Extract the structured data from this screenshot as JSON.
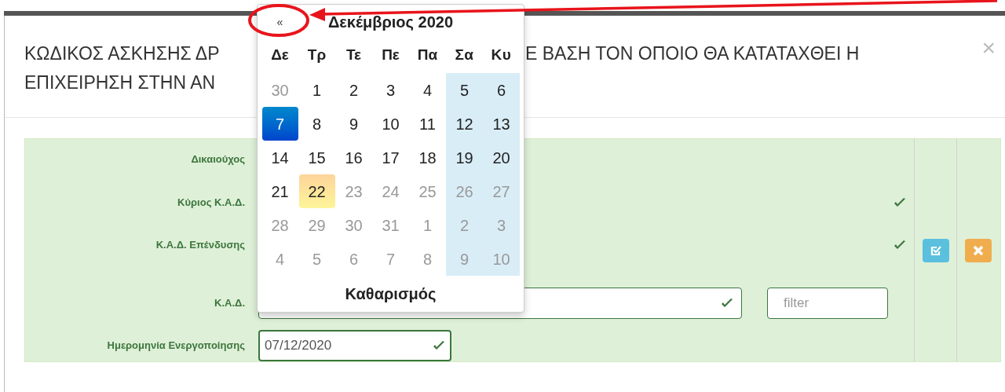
{
  "modal": {
    "title_parts": [
      "ΚΩΔΙΚΟΣ ΑΣΚΗΣΗΣ ΔΡ",
      "Ε ΒΑΣΗ ΤΟΝ ΟΠΟΙΟ ΘΑ ΚΑΤΑΤΑΧΘΕΙ Η",
      "ΕΠΙΧΕΙΡΗΣΗ ΣΤΗΝ ΑΝ"
    ],
    "close": "×"
  },
  "form": {
    "rows": [
      {
        "label": "Δικαιούχος",
        "kind": "plain",
        "valid": false
      },
      {
        "label": "Κύριος Κ.Α.Δ.",
        "kind": "plain",
        "valid": true
      },
      {
        "label": "Κ.Α.Δ. Επένδυσης",
        "kind": "plain",
        "valid": true
      },
      {
        "label": "Κ.Α.Δ.",
        "kind": "select",
        "valid": true,
        "filter_placeholder": "filter"
      },
      {
        "label": "Ημερομηνία Ενεργοποίησης",
        "kind": "date",
        "valid": true,
        "value": "07/12/2020"
      }
    ],
    "actions": [
      {
        "kind": "edit"
      },
      {
        "kind": "delete"
      }
    ]
  },
  "calendar": {
    "prev": "«",
    "title": "Δεκέμβριος 2020",
    "clear": "Καθαρισμός",
    "weekdays": [
      {
        "label": "Δε",
        "weekend": false
      },
      {
        "label": "Τρ",
        "weekend": false
      },
      {
        "label": "Τε",
        "weekend": false
      },
      {
        "label": "Πε",
        "weekend": false
      },
      {
        "label": "Πα",
        "weekend": false
      },
      {
        "label": "Σα",
        "weekend": true
      },
      {
        "label": "Κυ",
        "weekend": true
      }
    ],
    "weeks": [
      [
        {
          "day": "30",
          "muted": true,
          "selected": false,
          "today": false
        },
        {
          "day": "1",
          "muted": false,
          "selected": false,
          "today": false
        },
        {
          "day": "2",
          "muted": false,
          "selected": false,
          "today": false
        },
        {
          "day": "3",
          "muted": false,
          "selected": false,
          "today": false
        },
        {
          "day": "4",
          "muted": false,
          "selected": false,
          "today": false
        },
        {
          "day": "5",
          "muted": false,
          "selected": false,
          "today": false
        },
        {
          "day": "6",
          "muted": false,
          "selected": false,
          "today": false
        }
      ],
      [
        {
          "day": "7",
          "muted": false,
          "selected": true,
          "today": false
        },
        {
          "day": "8",
          "muted": false,
          "selected": false,
          "today": false
        },
        {
          "day": "9",
          "muted": false,
          "selected": false,
          "today": false
        },
        {
          "day": "10",
          "muted": false,
          "selected": false,
          "today": false
        },
        {
          "day": "11",
          "muted": false,
          "selected": false,
          "today": false
        },
        {
          "day": "12",
          "muted": false,
          "selected": false,
          "today": false
        },
        {
          "day": "13",
          "muted": false,
          "selected": false,
          "today": false
        }
      ],
      [
        {
          "day": "14",
          "muted": false,
          "selected": false,
          "today": false
        },
        {
          "day": "15",
          "muted": false,
          "selected": false,
          "today": false
        },
        {
          "day": "16",
          "muted": false,
          "selected": false,
          "today": false
        },
        {
          "day": "17",
          "muted": false,
          "selected": false,
          "today": false
        },
        {
          "day": "18",
          "muted": false,
          "selected": false,
          "today": false
        },
        {
          "day": "19",
          "muted": false,
          "selected": false,
          "today": false
        },
        {
          "day": "20",
          "muted": false,
          "selected": false,
          "today": false
        }
      ],
      [
        {
          "day": "21",
          "muted": false,
          "selected": false,
          "today": false
        },
        {
          "day": "22",
          "muted": false,
          "selected": false,
          "today": true
        },
        {
          "day": "23",
          "muted": true,
          "selected": false,
          "today": false
        },
        {
          "day": "24",
          "muted": true,
          "selected": false,
          "today": false
        },
        {
          "day": "25",
          "muted": true,
          "selected": false,
          "today": false
        },
        {
          "day": "26",
          "muted": true,
          "selected": false,
          "today": false
        },
        {
          "day": "27",
          "muted": true,
          "selected": false,
          "today": false
        }
      ],
      [
        {
          "day": "28",
          "muted": true,
          "selected": false,
          "today": false
        },
        {
          "day": "29",
          "muted": true,
          "selected": false,
          "today": false
        },
        {
          "day": "30",
          "muted": true,
          "selected": false,
          "today": false
        },
        {
          "day": "31",
          "muted": true,
          "selected": false,
          "today": false
        },
        {
          "day": "1",
          "muted": true,
          "selected": false,
          "today": false
        },
        {
          "day": "2",
          "muted": true,
          "selected": false,
          "today": false
        },
        {
          "day": "3",
          "muted": true,
          "selected": false,
          "today": false
        }
      ],
      [
        {
          "day": "4",
          "muted": true,
          "selected": false,
          "today": false
        },
        {
          "day": "5",
          "muted": true,
          "selected": false,
          "today": false
        },
        {
          "day": "6",
          "muted": true,
          "selected": false,
          "today": false
        },
        {
          "day": "7",
          "muted": true,
          "selected": false,
          "today": false
        },
        {
          "day": "8",
          "muted": true,
          "selected": false,
          "today": false
        },
        {
          "day": "9",
          "muted": true,
          "selected": false,
          "today": false
        },
        {
          "day": "10",
          "muted": true,
          "selected": false,
          "today": false
        }
      ]
    ]
  }
}
